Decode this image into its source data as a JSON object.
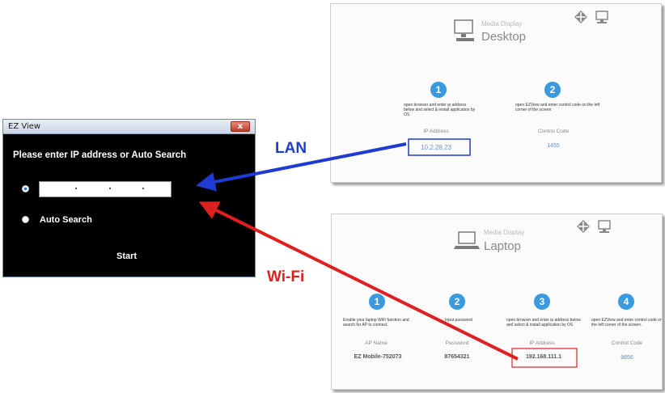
{
  "dialog": {
    "title": "EZ View",
    "close_glyph": "x",
    "prompt": "Please enter IP address or Auto Search",
    "ip_value": "",
    "auto_search_label": "Auto Search",
    "start_label": "Start"
  },
  "connection_labels": {
    "lan": "LAN",
    "wifi": "Wi-Fi"
  },
  "desktop_panel": {
    "subtitle": "Media Display",
    "title": "Desktop",
    "icons": [
      "monitor-icon",
      "network-icon",
      "computer-icon"
    ],
    "steps": [
      {
        "number": "1",
        "desc": "open browser and enter ip address below and select & install application by OS",
        "label": "IP Address",
        "value": "10.2.28.23"
      },
      {
        "number": "2",
        "desc": "open EZView and enter control code on the left corner of the screen",
        "label": "Control Code",
        "value": "1455"
      }
    ]
  },
  "laptop_panel": {
    "subtitle": "Media Display",
    "title": "Laptop",
    "icons": [
      "laptop-icon",
      "network-icon",
      "computer-icon"
    ],
    "steps": [
      {
        "number": "1",
        "desc": "Enable your laptop WiFi function and search for AP to connect.",
        "label": "AP Name",
        "value": "EZ Mobile-752073"
      },
      {
        "number": "2",
        "desc": "Input password",
        "label": "Password",
        "value": "87654321"
      },
      {
        "number": "3",
        "desc": "open browser and enter ip address below and select & install application by OS",
        "label": "IP Address",
        "value": "192.168.111.1"
      },
      {
        "number": "4",
        "desc": "open EZView and enter control code on the left corner of the screen.",
        "label": "Control Code",
        "value": "9856"
      }
    ]
  },
  "colors": {
    "lan_arrow": "#1f3bd1",
    "wifi_arrow": "#e02020",
    "step_circle": "#3a9ae0"
  }
}
